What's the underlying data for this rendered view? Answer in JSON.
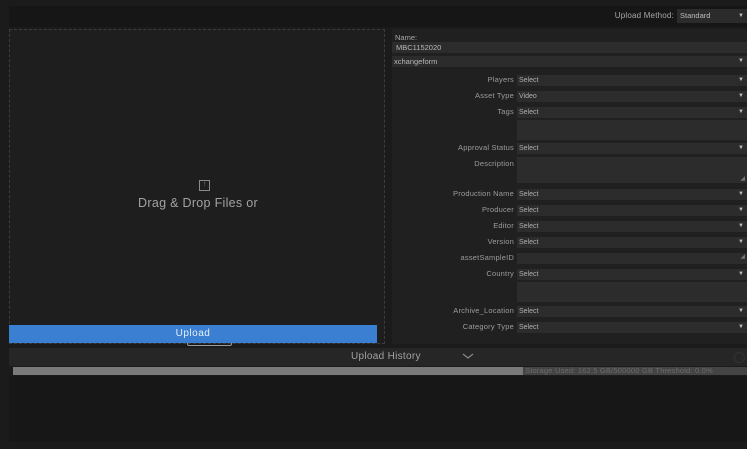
{
  "header": {
    "upload_method_label": "Upload Method:",
    "upload_method_value": "Standard"
  },
  "dropzone": {
    "text": "Drag & Drop Files or",
    "browse_label": "Browse",
    "upload_label": "Upload"
  },
  "form": {
    "name_label": "Name:",
    "name_value": "MBC1152020",
    "form_type": "xchangeform",
    "fields": [
      {
        "label": "Players",
        "value": "Select"
      },
      {
        "label": "Asset Type",
        "value": "Video"
      },
      {
        "label": "Tags",
        "value": "Select"
      },
      {
        "label": "Approval Status",
        "value": "Select"
      },
      {
        "label": "Description",
        "value": ""
      },
      {
        "label": "Production Name",
        "value": "Select"
      },
      {
        "label": "Producer",
        "value": "Select"
      },
      {
        "label": "Editor",
        "value": "Select"
      },
      {
        "label": "Version",
        "value": "Select"
      },
      {
        "label": "assetSampleID",
        "value": ""
      },
      {
        "label": "Country",
        "value": "Select"
      },
      {
        "label": "Archive_Location",
        "value": "Select"
      },
      {
        "label": "Category Type",
        "value": "Select"
      }
    ]
  },
  "history": {
    "label": "Upload History",
    "storage_text": "Storage Used: 162.5 GB/500000 GB  Threshold: 0.0%"
  },
  "colors": {
    "accent": "#3b7fd3",
    "background": "#1b1b1b"
  }
}
